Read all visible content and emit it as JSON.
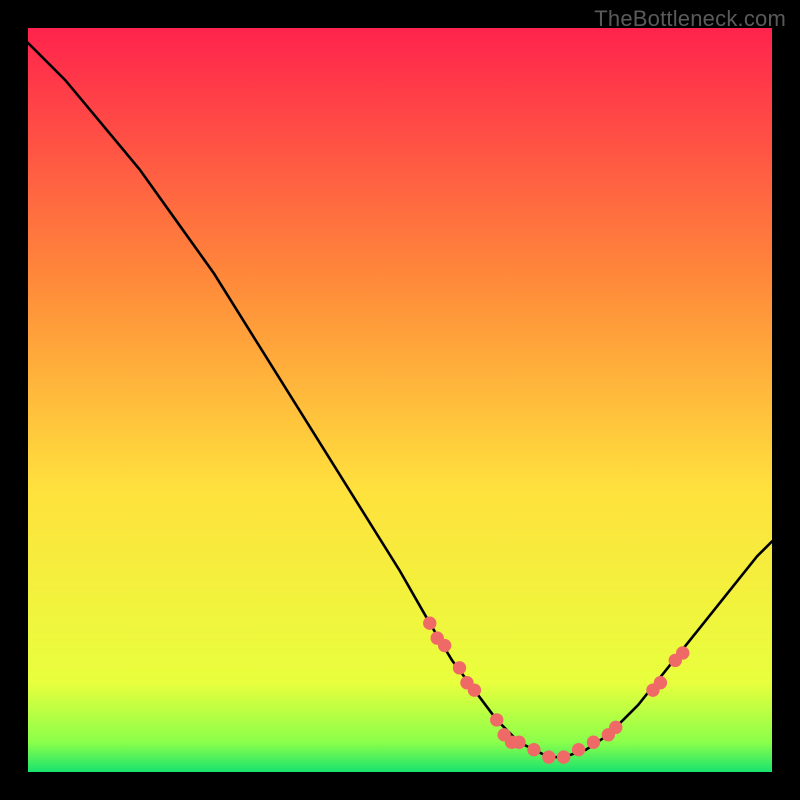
{
  "watermark": "TheBottleneck.com",
  "colors": {
    "bg": "#000000",
    "watermark": "#5a5a5a",
    "curve": "#000000",
    "dot": "#ef6a66",
    "gradient_top": "#ff234d",
    "gradient_mid": "#ffe13d",
    "gradient_low": "#caff3d",
    "gradient_bottom": "#19e36e"
  },
  "chart_data": {
    "type": "line",
    "title": "",
    "xlabel": "",
    "ylabel": "",
    "xlim": [
      0,
      100
    ],
    "ylim": [
      0,
      100
    ],
    "series": [
      {
        "name": "bottleneck-curve",
        "x": [
          0,
          5,
          10,
          15,
          20,
          25,
          30,
          35,
          40,
          45,
          50,
          54,
          57,
          60,
          63,
          66,
          68,
          70,
          72,
          75,
          78,
          82,
          86,
          90,
          94,
          98,
          100
        ],
        "y": [
          98,
          93,
          87,
          81,
          74,
          67,
          59,
          51,
          43,
          35,
          27,
          20,
          15,
          11,
          7,
          4,
          3,
          2,
          2,
          3,
          5,
          9,
          14,
          19,
          24,
          29,
          31
        ]
      }
    ],
    "annotations": [
      {
        "x": 54,
        "y": 20
      },
      {
        "x": 55,
        "y": 18
      },
      {
        "x": 56,
        "y": 17
      },
      {
        "x": 58,
        "y": 14
      },
      {
        "x": 59,
        "y": 12
      },
      {
        "x": 60,
        "y": 11
      },
      {
        "x": 63,
        "y": 7
      },
      {
        "x": 64,
        "y": 5
      },
      {
        "x": 65,
        "y": 4
      },
      {
        "x": 66,
        "y": 4
      },
      {
        "x": 68,
        "y": 3
      },
      {
        "x": 70,
        "y": 2
      },
      {
        "x": 72,
        "y": 2
      },
      {
        "x": 74,
        "y": 3
      },
      {
        "x": 76,
        "y": 4
      },
      {
        "x": 78,
        "y": 5
      },
      {
        "x": 79,
        "y": 6
      },
      {
        "x": 84,
        "y": 11
      },
      {
        "x": 85,
        "y": 12
      },
      {
        "x": 87,
        "y": 15
      },
      {
        "x": 88,
        "y": 16
      }
    ]
  }
}
